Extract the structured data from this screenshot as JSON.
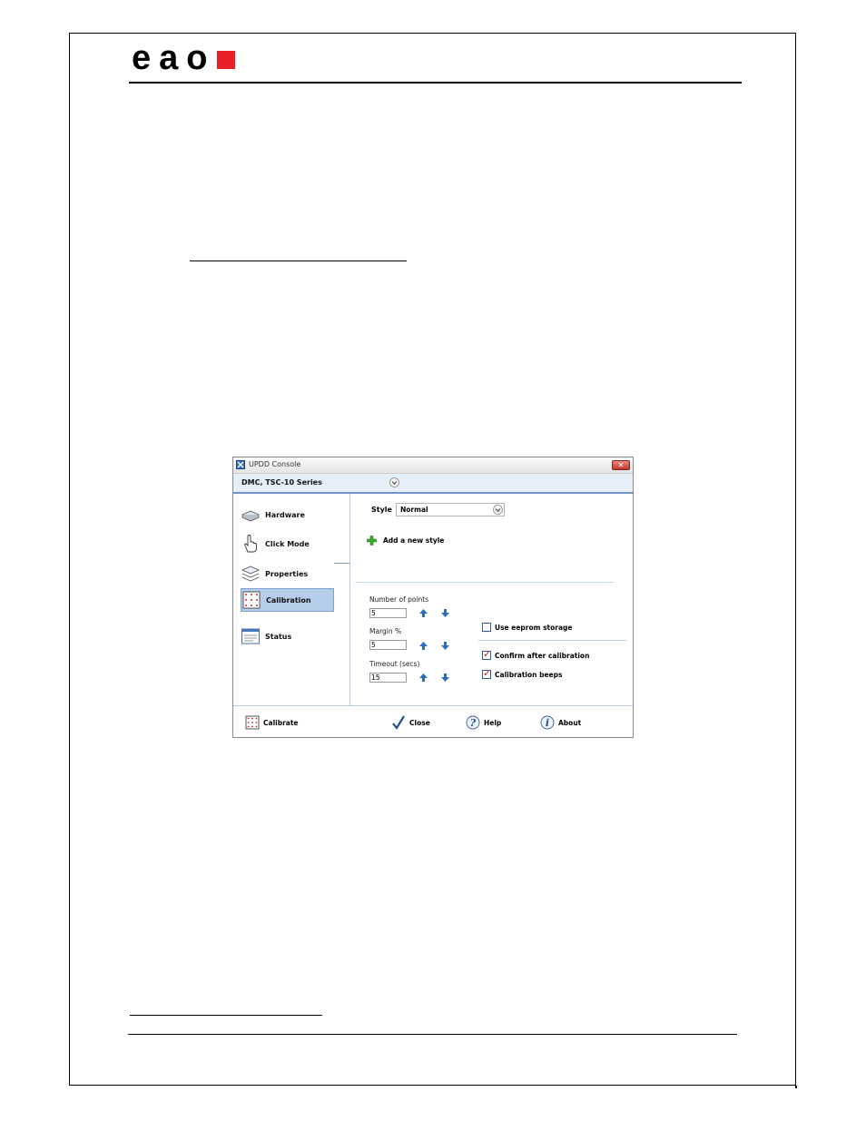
{
  "document": {
    "logo_text": "eao",
    "logo_color": "#e8202a"
  },
  "window": {
    "title": "UPDD Console",
    "close_symbol": "✕",
    "device_name": "DMC, TSC-10 Series",
    "sidebar": [
      {
        "label": "Hardware",
        "icon": "hardware-icon"
      },
      {
        "label": "Click Mode",
        "icon": "hand-pointer-icon"
      },
      {
        "label": "Properties",
        "icon": "layers-icon"
      },
      {
        "label": "Calibration",
        "icon": "calibration-grid-icon",
        "active": true
      },
      {
        "label": "Status",
        "icon": "status-window-icon"
      }
    ],
    "style_label": "Style",
    "style_value": "Normal",
    "add_style_label": "Add a new style",
    "fields": {
      "points": {
        "label": "Number of points",
        "value": "5"
      },
      "margin": {
        "label": "Margin %",
        "value": "5"
      },
      "timeout": {
        "label": "Timeout (secs)",
        "value": "15"
      }
    },
    "checkboxes": {
      "eeprom": {
        "label": "Use eeprom storage",
        "checked": false
      },
      "confirm": {
        "label": "Confirm after calibration",
        "checked": true
      },
      "beeps": {
        "label": "Calibration beeps",
        "checked": true
      }
    },
    "buttons": {
      "calibrate": "Calibrate",
      "close": "Close",
      "help": "Help",
      "about": "About"
    },
    "accent_color": "#6f93c8"
  }
}
